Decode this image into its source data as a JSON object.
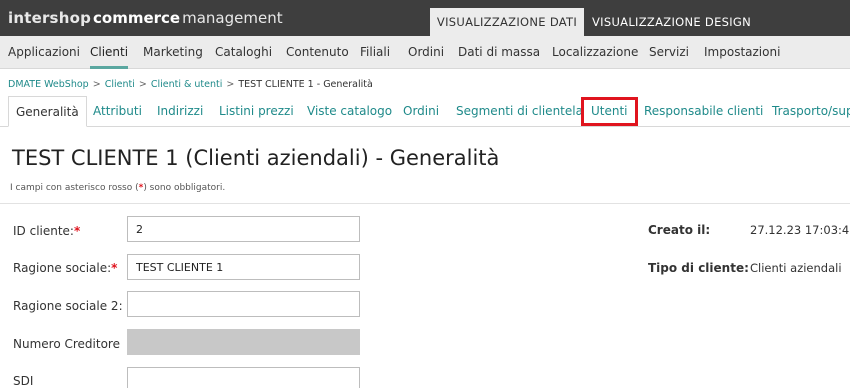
{
  "topbar": {
    "logo_brand": "intershop",
    "logo_commerce": "commerce",
    "logo_management": "management",
    "view_tabs": [
      "VISUALIZZAZIONE DATI",
      "VISUALIZZAZIONE DESIGN"
    ],
    "active_view": "VISUALIZZAZIONE DATI"
  },
  "main_nav": {
    "items": [
      "Applicazioni",
      "Clienti",
      "Marketing",
      "Cataloghi",
      "Contenuto",
      "Filiali",
      "Ordini",
      "Dati di massa",
      "Localizzazione",
      "Servizi",
      "Impostazioni"
    ],
    "active": "Clienti"
  },
  "breadcrumb": {
    "items": [
      "DMATE WebShop",
      "Clienti",
      "Clienti & utenti"
    ],
    "current": "TEST CLIENTE 1 - Generalità",
    "separator": ">"
  },
  "sub_tabs": {
    "items": [
      "Generalità",
      "Attributi",
      "Indirizzi",
      "Listini prezzi",
      "Viste catalogo",
      "Ordini",
      "Segmenti di clientela",
      "Utenti",
      "Responsabile clienti",
      "Trasporto/sup"
    ],
    "active": "Generalità",
    "highlighted": "Utenti"
  },
  "page": {
    "title": "TEST CLIENTE 1 (Clienti aziendali) - Generalità",
    "required_note_prefix": "I campi con asterisco rosso (",
    "required_note_star": "*",
    "required_note_suffix": ") sono obbligatori."
  },
  "form": {
    "customer_id": {
      "label": "ID cliente:",
      "required": "*",
      "value": "2"
    },
    "company_name": {
      "label": "Ragione sociale:",
      "required": "*",
      "value": "TEST CLIENTE 1"
    },
    "company_name_2": {
      "label": "Ragione sociale 2:",
      "value": ""
    },
    "creditor_number": {
      "label": "Numero Creditore",
      "value": ""
    },
    "sdi": {
      "label": "SDI",
      "value": ""
    }
  },
  "info": {
    "created_label": "Creato il:",
    "created_value": "27.12.23 17:03:4",
    "customer_type_label": "Tipo di cliente:",
    "customer_type_value": "Clienti aziendali"
  },
  "colors": {
    "topbar_bg": "#3e3e3e",
    "link": "#1f8a8a",
    "accent": "#5aa7a0",
    "required_star": "#e0141e",
    "highlight_box": "#e0141e"
  }
}
